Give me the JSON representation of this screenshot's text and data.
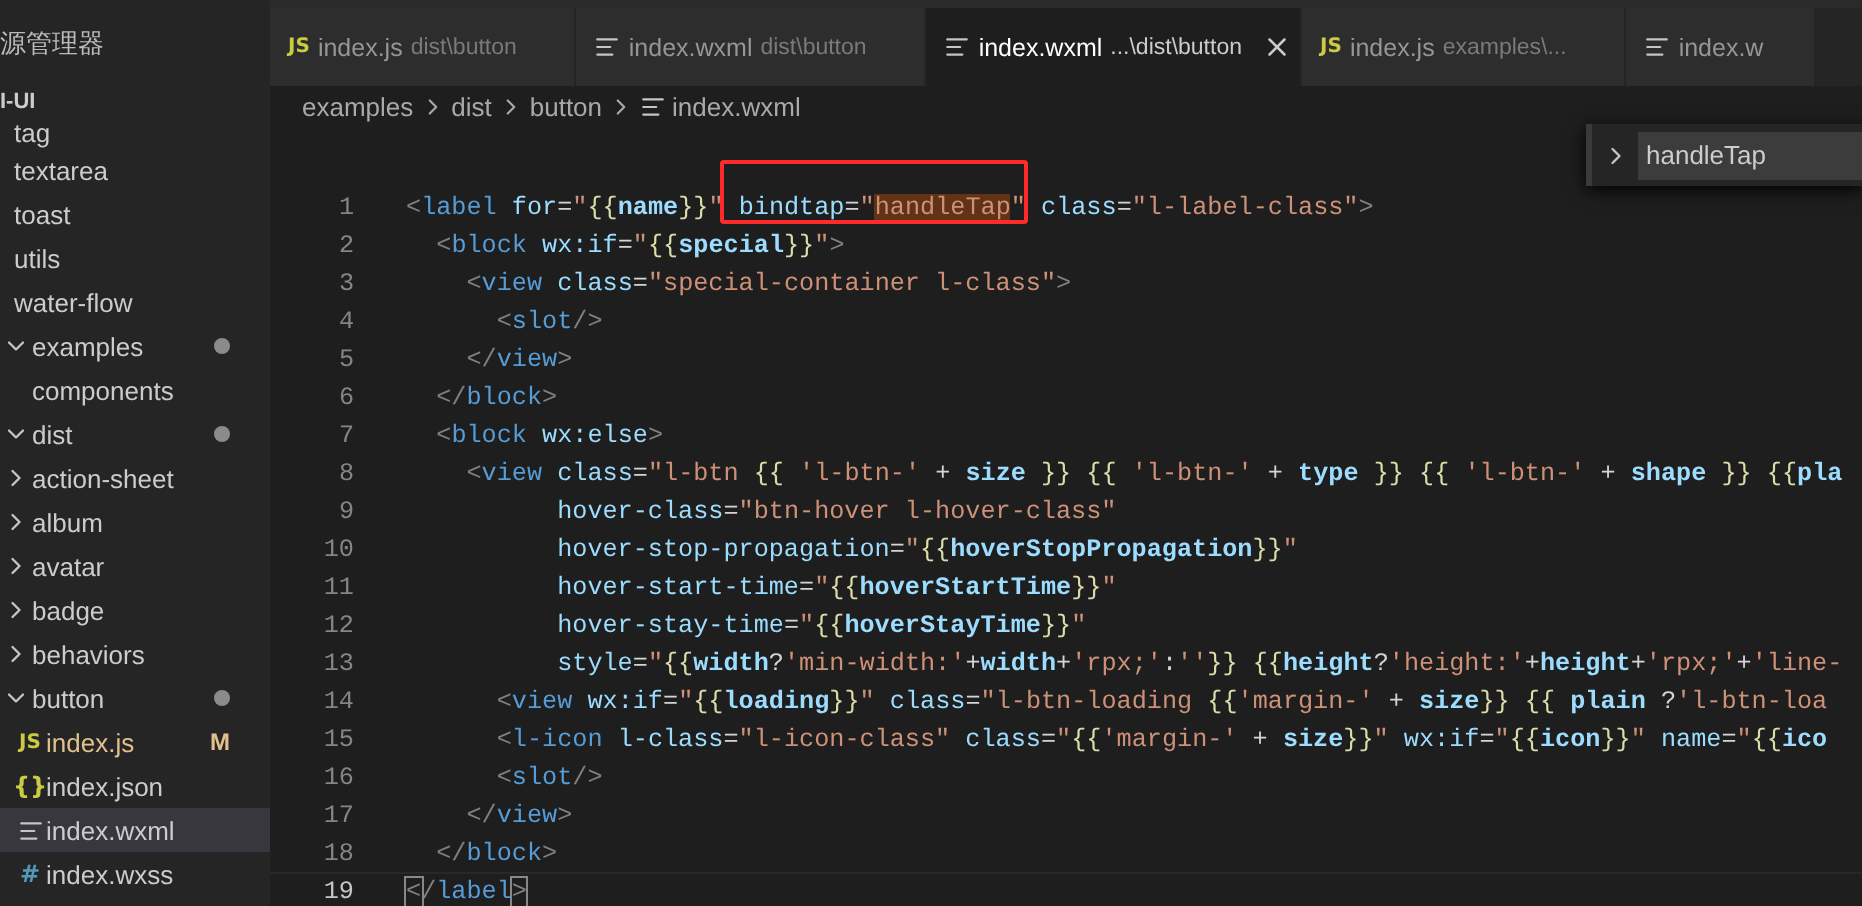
{
  "explorer": {
    "title": "源管理器",
    "root": "I-UI",
    "partial_items": [
      {
        "label": "tag",
        "selected": false
      },
      {
        "label": "textarea",
        "selected": false
      },
      {
        "label": "toast",
        "selected": false
      },
      {
        "label": "utils",
        "selected": false
      },
      {
        "label": "water-flow",
        "selected": false
      }
    ],
    "items": [
      {
        "label": "examples",
        "kind": "folder",
        "expanded": true,
        "modified": true,
        "selected": false,
        "children": [
          {
            "label": "components",
            "kind": "plain",
            "selected": false
          },
          {
            "label": "dist",
            "kind": "folder",
            "expanded": true,
            "modified": true,
            "selected": false,
            "children": [
              {
                "label": "action-sheet",
                "kind": "folder",
                "expanded": false,
                "selected": false
              },
              {
                "label": "album",
                "kind": "folder",
                "expanded": false,
                "selected": false
              },
              {
                "label": "avatar",
                "kind": "folder",
                "expanded": false,
                "selected": false
              },
              {
                "label": "badge",
                "kind": "folder",
                "expanded": false,
                "selected": false
              },
              {
                "label": "behaviors",
                "kind": "folder",
                "expanded": false,
                "selected": false
              },
              {
                "label": "button",
                "kind": "folder",
                "expanded": true,
                "modified": true,
                "selected": false,
                "children": [
                  {
                    "label": "index.js",
                    "kind": "js",
                    "glyph": "JS",
                    "status": "M",
                    "selected": false
                  },
                  {
                    "label": "index.json",
                    "kind": "json",
                    "glyph": "{}",
                    "selected": false
                  },
                  {
                    "label": "index.wxml",
                    "kind": "wxml",
                    "selected": true
                  },
                  {
                    "label": "index.wxss",
                    "kind": "css",
                    "glyph": "#",
                    "selected": false
                  }
                ]
              }
            ]
          }
        ]
      }
    ]
  },
  "tabs": [
    {
      "label": "index.js",
      "detail": "dist\\button",
      "kind": "js",
      "glyph": "JS",
      "selected": false
    },
    {
      "label": "index.wxml",
      "detail": "dist\\button",
      "kind": "wxml",
      "selected": false
    },
    {
      "label": "index.wxml",
      "detail": "...\\dist\\button",
      "kind": "wxml",
      "selected": true
    },
    {
      "label": "index.js",
      "detail": "examples\\...",
      "kind": "js",
      "glyph": "JS",
      "selected": false
    },
    {
      "label": "index.w",
      "kind": "wxml",
      "selected": false
    }
  ],
  "breadcrumb": [
    {
      "label": "examples",
      "kind": "folder"
    },
    {
      "label": "dist",
      "kind": "folder"
    },
    {
      "label": "button",
      "kind": "folder"
    },
    {
      "label": "index.wxml",
      "kind": "wxml"
    }
  ],
  "find_widget": {
    "value": "handleTap"
  },
  "code": [
    {
      "number": "1",
      "current": false,
      "segments": [
        {
          "kind": "p",
          "text": "<"
        },
        {
          "kind": "tag",
          "text": "label"
        },
        {
          "kind": "attr",
          "text": " for"
        },
        {
          "kind": "op",
          "text": "="
        },
        {
          "kind": "str",
          "text": "\""
        },
        {
          "kind": "brace",
          "text": "{{"
        },
        {
          "kind": "var",
          "text": "name"
        },
        {
          "kind": "brace",
          "text": "}}"
        },
        {
          "kind": "str",
          "text": "\""
        },
        {
          "kind": "attr",
          "text": " bindtap"
        },
        {
          "kind": "op",
          "text": "="
        },
        {
          "kind": "str",
          "text": "\""
        },
        {
          "kind": "hl",
          "text": "handleTap"
        },
        {
          "kind": "str",
          "text": "\""
        },
        {
          "kind": "attr",
          "text": " class"
        },
        {
          "kind": "op",
          "text": "="
        },
        {
          "kind": "str",
          "text": "\"l-label-class\""
        },
        {
          "kind": "p",
          "text": ">"
        }
      ]
    },
    {
      "number": "2",
      "current": false,
      "segments": [
        {
          "kind": "p",
          "text": "  <"
        },
        {
          "kind": "tag",
          "text": "block"
        },
        {
          "kind": "attr",
          "text": " wx:if"
        },
        {
          "kind": "op",
          "text": "="
        },
        {
          "kind": "str",
          "text": "\""
        },
        {
          "kind": "brace",
          "text": "{{"
        },
        {
          "kind": "var",
          "text": "special"
        },
        {
          "kind": "brace",
          "text": "}}"
        },
        {
          "kind": "str",
          "text": "\""
        },
        {
          "kind": "p",
          "text": ">"
        }
      ]
    },
    {
      "number": "3",
      "current": false,
      "segments": [
        {
          "kind": "p",
          "text": "    <"
        },
        {
          "kind": "tag",
          "text": "view"
        },
        {
          "kind": "attr",
          "text": " class"
        },
        {
          "kind": "op",
          "text": "="
        },
        {
          "kind": "str",
          "text": "\"special-container l-class\""
        },
        {
          "kind": "p",
          "text": ">"
        }
      ]
    },
    {
      "number": "4",
      "current": false,
      "segments": [
        {
          "kind": "p",
          "text": "      <"
        },
        {
          "kind": "tag",
          "text": "slot"
        },
        {
          "kind": "p",
          "text": "/>"
        }
      ]
    },
    {
      "number": "5",
      "current": false,
      "segments": [
        {
          "kind": "p",
          "text": "    </"
        },
        {
          "kind": "tag",
          "text": "view"
        },
        {
          "kind": "p",
          "text": ">"
        }
      ]
    },
    {
      "number": "6",
      "current": false,
      "segments": [
        {
          "kind": "p",
          "text": "  </"
        },
        {
          "kind": "tag",
          "text": "block"
        },
        {
          "kind": "p",
          "text": ">"
        }
      ]
    },
    {
      "number": "7",
      "current": false,
      "segments": [
        {
          "kind": "p",
          "text": "  <"
        },
        {
          "kind": "tag",
          "text": "block"
        },
        {
          "kind": "attr",
          "text": " wx:else"
        },
        {
          "kind": "p",
          "text": ">"
        }
      ]
    },
    {
      "number": "8",
      "current": false,
      "segments": [
        {
          "kind": "p",
          "text": "    <"
        },
        {
          "kind": "tag",
          "text": "view"
        },
        {
          "kind": "attr",
          "text": " class"
        },
        {
          "kind": "op",
          "text": "="
        },
        {
          "kind": "str",
          "text": "\"l-btn "
        },
        {
          "kind": "brace",
          "text": "{{"
        },
        {
          "kind": "str",
          "text": " 'l-btn-'"
        },
        {
          "kind": "op",
          "text": " + "
        },
        {
          "kind": "var",
          "text": "size"
        },
        {
          "kind": "brace",
          "text": " }}"
        },
        {
          "kind": "brace",
          "text": " {{"
        },
        {
          "kind": "str",
          "text": " 'l-btn-'"
        },
        {
          "kind": "op",
          "text": " + "
        },
        {
          "kind": "var",
          "text": "type"
        },
        {
          "kind": "brace",
          "text": " }}"
        },
        {
          "kind": "brace",
          "text": " {{"
        },
        {
          "kind": "str",
          "text": " 'l-btn-'"
        },
        {
          "kind": "op",
          "text": " + "
        },
        {
          "kind": "var",
          "text": "shape"
        },
        {
          "kind": "brace",
          "text": " }}"
        },
        {
          "kind": "brace",
          "text": " {{"
        },
        {
          "kind": "var",
          "text": "pla"
        }
      ]
    },
    {
      "number": "9",
      "current": false,
      "segments": [
        {
          "kind": "attr",
          "text": "          hover-class"
        },
        {
          "kind": "op",
          "text": "="
        },
        {
          "kind": "str",
          "text": "\"btn-hover l-hover-class\""
        }
      ]
    },
    {
      "number": "10",
      "current": false,
      "segments": [
        {
          "kind": "attr",
          "text": "          hover-stop-propagation"
        },
        {
          "kind": "op",
          "text": "="
        },
        {
          "kind": "str",
          "text": "\""
        },
        {
          "kind": "brace",
          "text": "{{"
        },
        {
          "kind": "var",
          "text": "hoverStopPropagation"
        },
        {
          "kind": "brace",
          "text": "}}"
        },
        {
          "kind": "str",
          "text": "\""
        }
      ]
    },
    {
      "number": "11",
      "current": false,
      "segments": [
        {
          "kind": "attr",
          "text": "          hover-start-time"
        },
        {
          "kind": "op",
          "text": "="
        },
        {
          "kind": "str",
          "text": "\""
        },
        {
          "kind": "brace",
          "text": "{{"
        },
        {
          "kind": "var",
          "text": "hoverStartTime"
        },
        {
          "kind": "brace",
          "text": "}}"
        },
        {
          "kind": "str",
          "text": "\""
        }
      ]
    },
    {
      "number": "12",
      "current": false,
      "segments": [
        {
          "kind": "attr",
          "text": "          hover-stay-time"
        },
        {
          "kind": "op",
          "text": "="
        },
        {
          "kind": "str",
          "text": "\""
        },
        {
          "kind": "brace",
          "text": "{{"
        },
        {
          "kind": "var",
          "text": "hoverStayTime"
        },
        {
          "kind": "brace",
          "text": "}}"
        },
        {
          "kind": "str",
          "text": "\""
        }
      ]
    },
    {
      "number": "13",
      "current": false,
      "segments": [
        {
          "kind": "attr",
          "text": "          style"
        },
        {
          "kind": "op",
          "text": "="
        },
        {
          "kind": "str",
          "text": "\""
        },
        {
          "kind": "brace",
          "text": "{{"
        },
        {
          "kind": "var",
          "text": "width"
        },
        {
          "kind": "op",
          "text": "?"
        },
        {
          "kind": "str",
          "text": "'min-width:'"
        },
        {
          "kind": "op",
          "text": "+"
        },
        {
          "kind": "var",
          "text": "width"
        },
        {
          "kind": "op",
          "text": "+"
        },
        {
          "kind": "str",
          "text": "'rpx;'"
        },
        {
          "kind": "op",
          "text": ":"
        },
        {
          "kind": "str",
          "text": "''"
        },
        {
          "kind": "brace",
          "text": "}}"
        },
        {
          "kind": "brace",
          "text": " {{"
        },
        {
          "kind": "var",
          "text": "height"
        },
        {
          "kind": "op",
          "text": "?"
        },
        {
          "kind": "str",
          "text": "'height:'"
        },
        {
          "kind": "op",
          "text": "+"
        },
        {
          "kind": "var",
          "text": "height"
        },
        {
          "kind": "op",
          "text": "+"
        },
        {
          "kind": "str",
          "text": "'rpx;'"
        },
        {
          "kind": "op",
          "text": "+"
        },
        {
          "kind": "str",
          "text": "'line-"
        }
      ]
    },
    {
      "number": "14",
      "current": false,
      "segments": [
        {
          "kind": "p",
          "text": "      <"
        },
        {
          "kind": "tag",
          "text": "view"
        },
        {
          "kind": "attr",
          "text": " wx:if"
        },
        {
          "kind": "op",
          "text": "="
        },
        {
          "kind": "str",
          "text": "\""
        },
        {
          "kind": "brace",
          "text": "{{"
        },
        {
          "kind": "var",
          "text": "loading"
        },
        {
          "kind": "brace",
          "text": "}}"
        },
        {
          "kind": "str",
          "text": "\""
        },
        {
          "kind": "attr",
          "text": " class"
        },
        {
          "kind": "op",
          "text": "="
        },
        {
          "kind": "str",
          "text": "\"l-btn-loading "
        },
        {
          "kind": "brace",
          "text": "{{"
        },
        {
          "kind": "str",
          "text": "'margin-'"
        },
        {
          "kind": "op",
          "text": " + "
        },
        {
          "kind": "var",
          "text": "size"
        },
        {
          "kind": "brace",
          "text": "}}"
        },
        {
          "kind": "brace",
          "text": " {{"
        },
        {
          "kind": "var",
          "text": " plain"
        },
        {
          "kind": "op",
          "text": " ?"
        },
        {
          "kind": "str",
          "text": "'l-btn-loa"
        }
      ]
    },
    {
      "number": "15",
      "current": false,
      "segments": [
        {
          "kind": "p",
          "text": "      <"
        },
        {
          "kind": "tag",
          "text": "l-icon"
        },
        {
          "kind": "attr",
          "text": " l-class"
        },
        {
          "kind": "op",
          "text": "="
        },
        {
          "kind": "str",
          "text": "\"l-icon-class\""
        },
        {
          "kind": "attr",
          "text": " class"
        },
        {
          "kind": "op",
          "text": "="
        },
        {
          "kind": "str",
          "text": "\""
        },
        {
          "kind": "brace",
          "text": "{{"
        },
        {
          "kind": "str",
          "text": "'margin-'"
        },
        {
          "kind": "op",
          "text": " + "
        },
        {
          "kind": "var",
          "text": "size"
        },
        {
          "kind": "brace",
          "text": "}}"
        },
        {
          "kind": "str",
          "text": "\""
        },
        {
          "kind": "attr",
          "text": " wx:if"
        },
        {
          "kind": "op",
          "text": "="
        },
        {
          "kind": "str",
          "text": "\""
        },
        {
          "kind": "brace",
          "text": "{{"
        },
        {
          "kind": "var",
          "text": "icon"
        },
        {
          "kind": "brace",
          "text": "}}"
        },
        {
          "kind": "str",
          "text": "\""
        },
        {
          "kind": "attr",
          "text": " name"
        },
        {
          "kind": "op",
          "text": "="
        },
        {
          "kind": "str",
          "text": "\""
        },
        {
          "kind": "brace",
          "text": "{{"
        },
        {
          "kind": "var",
          "text": "ico"
        }
      ]
    },
    {
      "number": "16",
      "current": false,
      "segments": [
        {
          "kind": "p",
          "text": "      <"
        },
        {
          "kind": "tag",
          "text": "slot"
        },
        {
          "kind": "p",
          "text": "/>"
        }
      ]
    },
    {
      "number": "17",
      "current": false,
      "segments": [
        {
          "kind": "p",
          "text": "    </"
        },
        {
          "kind": "tag",
          "text": "view"
        },
        {
          "kind": "p",
          "text": ">"
        }
      ]
    },
    {
      "number": "18",
      "current": false,
      "segments": [
        {
          "kind": "p",
          "text": "  </"
        },
        {
          "kind": "tag",
          "text": "block"
        },
        {
          "kind": "p",
          "text": ">"
        }
      ]
    },
    {
      "number": "19",
      "current": true,
      "segments": [
        {
          "kind": "pm",
          "text": "<"
        },
        {
          "kind": "p",
          "text": "/"
        },
        {
          "kind": "tag",
          "text": "label"
        },
        {
          "kind": "pm",
          "text": ">"
        }
      ]
    }
  ]
}
